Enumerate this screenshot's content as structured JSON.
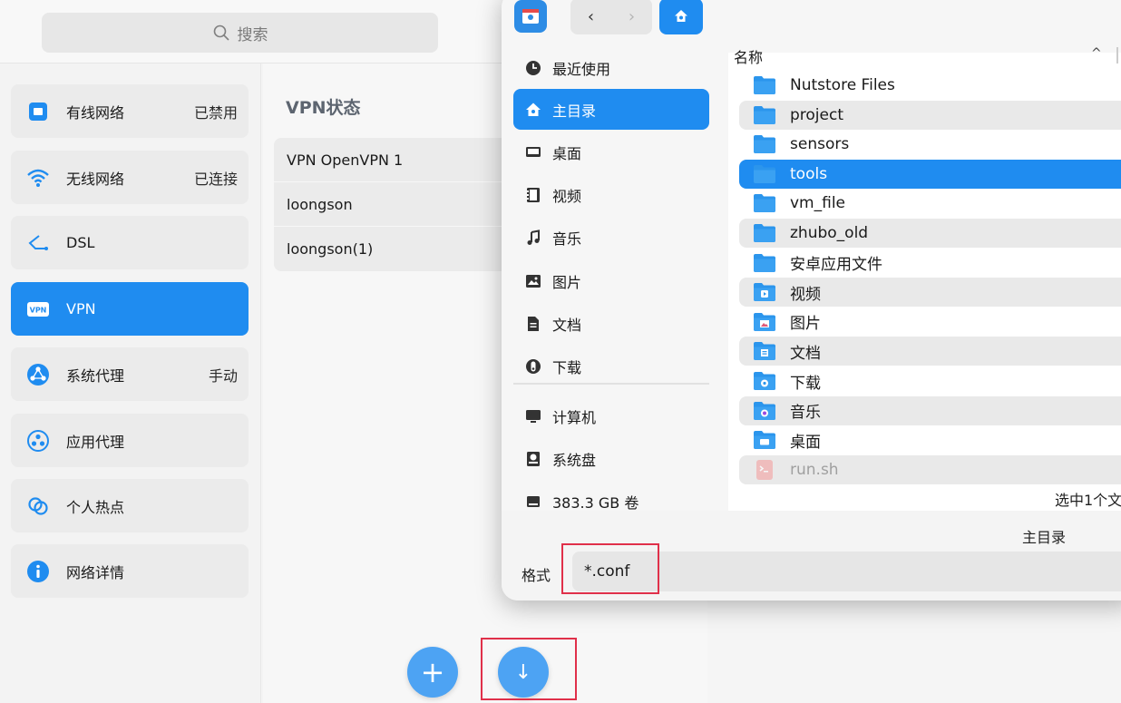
{
  "search": {
    "placeholder": "搜索"
  },
  "nav": {
    "items": [
      {
        "label": "有线网络",
        "status": "已禁用",
        "icon": "wired-icon"
      },
      {
        "label": "无线网络",
        "status": "已连接",
        "icon": "wifi-icon"
      },
      {
        "label": "DSL",
        "status": "",
        "icon": "dsl-icon"
      },
      {
        "label": "VPN",
        "status": "",
        "icon": "vpn-icon",
        "active": true
      },
      {
        "label": "系统代理",
        "status": "手动",
        "icon": "proxy-icon"
      },
      {
        "label": "应用代理",
        "status": "",
        "icon": "app-proxy-icon"
      },
      {
        "label": "个人热点",
        "status": "",
        "icon": "hotspot-icon"
      },
      {
        "label": "网络详情",
        "status": "",
        "icon": "info-icon"
      }
    ]
  },
  "vpn": {
    "title": "VPN状态",
    "connections": [
      "VPN OpenVPN 1",
      "loongson",
      "loongson(1)"
    ],
    "add_label": "+",
    "import_label": "↓"
  },
  "dialog": {
    "sidebar": [
      {
        "label": "最近使用",
        "icon": "clock-icon"
      },
      {
        "label": "主目录",
        "icon": "home-icon",
        "active": true
      },
      {
        "label": "桌面",
        "icon": "desktop-icon"
      },
      {
        "label": "视频",
        "icon": "video-icon"
      },
      {
        "label": "音乐",
        "icon": "music-icon"
      },
      {
        "label": "图片",
        "icon": "picture-icon"
      },
      {
        "label": "文档",
        "icon": "document-icon"
      },
      {
        "label": "下载",
        "icon": "download-icon"
      },
      {
        "label": "计算机",
        "icon": "computer-icon"
      },
      {
        "label": "系统盘",
        "icon": "disk-icon"
      },
      {
        "label": "383.3 GB 卷",
        "icon": "volume-icon"
      }
    ],
    "column_name": "名称",
    "sort_indicator": "^",
    "files": [
      {
        "name": "Nutstore Files",
        "type": "folder"
      },
      {
        "name": "project",
        "type": "folder"
      },
      {
        "name": "sensors",
        "type": "folder"
      },
      {
        "name": "tools",
        "type": "folder",
        "selected": true
      },
      {
        "name": "vm_file",
        "type": "folder"
      },
      {
        "name": "zhubo_old",
        "type": "folder"
      },
      {
        "name": "安卓应用文件",
        "type": "folder"
      },
      {
        "name": "视频",
        "type": "video-folder"
      },
      {
        "name": "图片",
        "type": "picture-folder"
      },
      {
        "name": "文档",
        "type": "document-folder"
      },
      {
        "name": "下载",
        "type": "download-folder"
      },
      {
        "name": "音乐",
        "type": "music-folder"
      },
      {
        "name": "桌面",
        "type": "desktop-folder"
      },
      {
        "name": "run.sh",
        "type": "script",
        "disabled": true
      }
    ],
    "selection_status": "选中1个文",
    "current_path": "主目录",
    "format_label": "格式",
    "format_value": "*.conf"
  },
  "colors": {
    "accent": "#1f8cf0",
    "highlight": "#e0304a",
    "folder": "#2b95ec"
  }
}
